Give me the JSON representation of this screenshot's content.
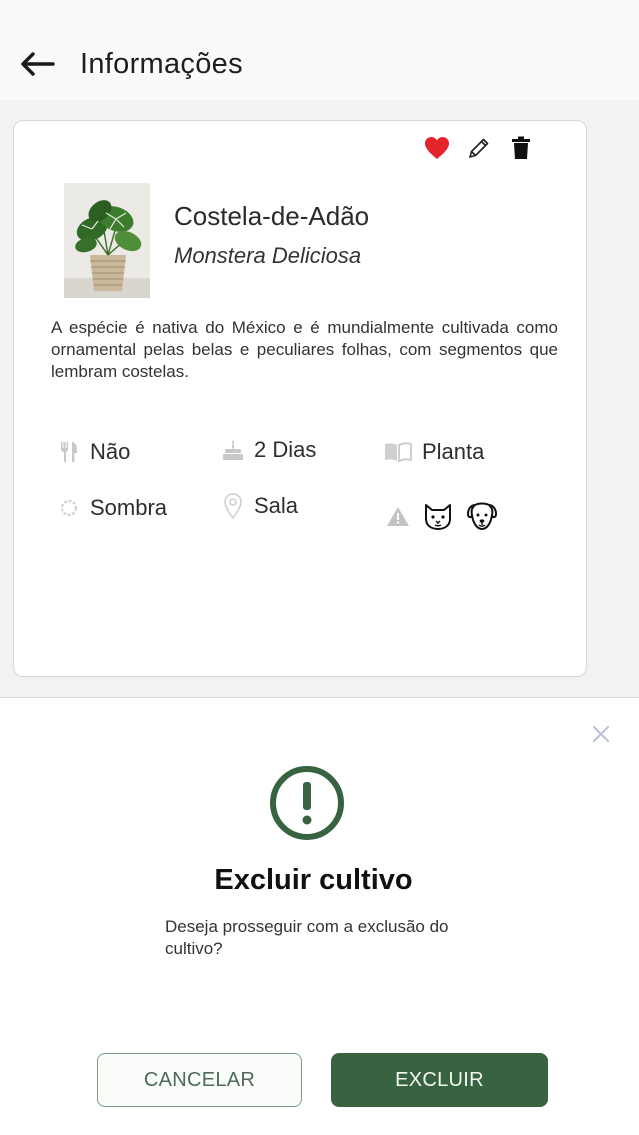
{
  "header": {
    "title": "Informações",
    "back_icon": "arrow-left-icon"
  },
  "card": {
    "actions": {
      "favorite_icon": "heart-icon",
      "edit_icon": "pencil-icon",
      "delete_icon": "trash-icon",
      "favorite_color": "#e3242b"
    },
    "plant_name": "Costela-de-Adão",
    "scientific_name": "Monstera Deliciosa",
    "description": "A espécie é nativa do México e é mundialmente cultivada como ornamental pelas belas e peculiares folhas, com segmentos que lembram costelas.",
    "attributes": {
      "edible": {
        "icon": "fork-knife-icon",
        "label": "Não"
      },
      "watering": {
        "icon": "cake-icon",
        "label": "2 Dias"
      },
      "category": {
        "icon": "book-icon",
        "label": "Planta"
      },
      "light": {
        "icon": "sun-icon",
        "label": "Sombra"
      },
      "location": {
        "icon": "location-pin-icon",
        "label": "Sala"
      },
      "toxicity": {
        "icon": "warning-icon",
        "pets": [
          "cat-icon",
          "dog-icon"
        ]
      }
    }
  },
  "dialog": {
    "close_icon": "close-icon",
    "alert_icon": "exclamation-circle-icon",
    "title": "Excluir cultivo",
    "message": "Deseja prosseguir com a exclusão do cultivo?",
    "cancel_label": "CANCELAR",
    "confirm_label": "EXCLUIR",
    "accent_color": "#386341"
  }
}
